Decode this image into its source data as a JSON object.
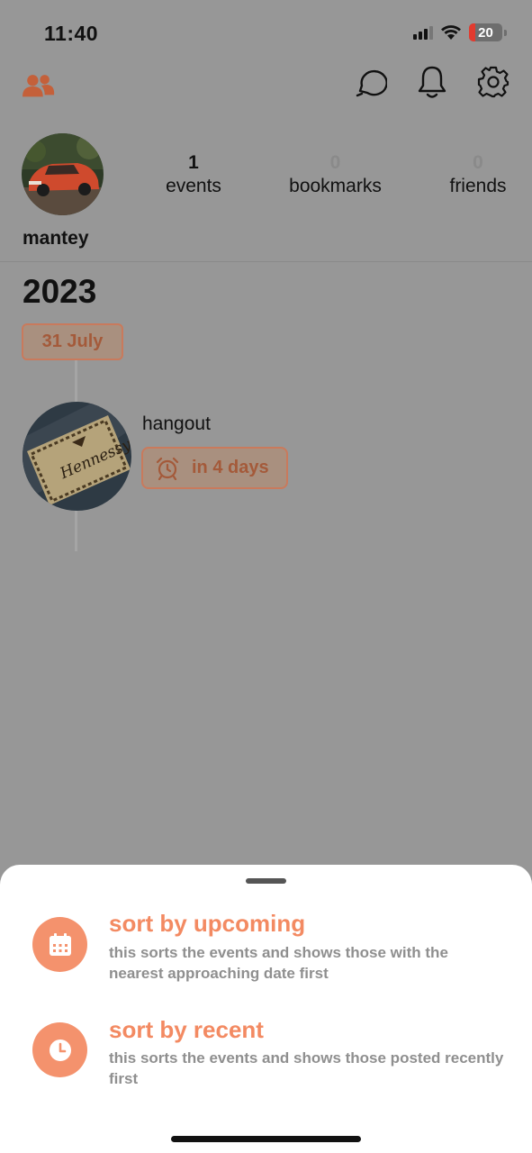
{
  "status_bar": {
    "time": "11:40",
    "battery": "20",
    "battery_level": 0.2
  },
  "profile": {
    "username": "mantey",
    "stats": [
      {
        "value": "1",
        "label": "events"
      },
      {
        "value": "0",
        "label": "bookmarks"
      },
      {
        "value": "0",
        "label": "friends"
      }
    ]
  },
  "timeline": {
    "year": "2023",
    "date": "31 July",
    "event": {
      "title": "hangout",
      "countdown": "in 4 days"
    }
  },
  "sort_sheet": {
    "options": [
      {
        "title": "sort by upcoming",
        "description": "this sorts the events and shows those with the nearest approaching date first",
        "icon": "calendar-icon"
      },
      {
        "title": "sort by recent",
        "description": "this sorts the events and shows those posted recently first",
        "icon": "clock-icon"
      }
    ]
  },
  "colors": {
    "accent": "#f38a62",
    "overlay": "#979797",
    "sheet": "#ffffff",
    "chip_text": "#a45a3a"
  }
}
